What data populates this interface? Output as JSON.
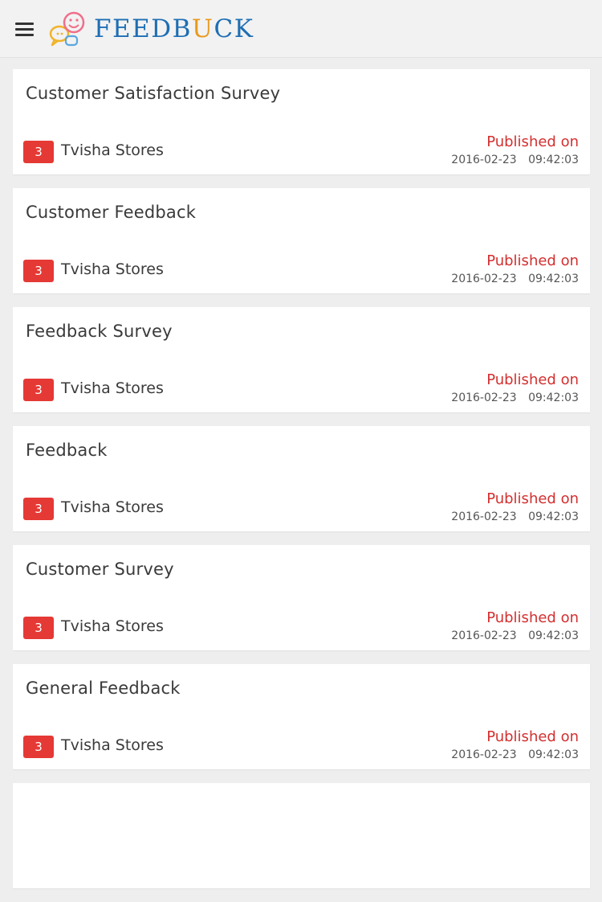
{
  "app": {
    "logo_text_before": "FEEDB",
    "logo_text_accent": "U",
    "logo_text_after": "CK",
    "logo_icon": "speech-bubbles-smiley-icon",
    "menu_icon": "hamburger-menu-icon",
    "colors": {
      "brand_blue": "#1e6eb3",
      "brand_orange": "#e89a1c",
      "badge_red": "#e53935",
      "published_red": "#d32f2f"
    }
  },
  "surveys": [
    {
      "title": "Customer Satisfaction Survey",
      "count": "3",
      "store": "Tvisha Stores",
      "published_label": "Published on",
      "published_at": "2016-02-23 09:42:03"
    },
    {
      "title": "Customer Feedback",
      "count": "3",
      "store": "Tvisha Stores",
      "published_label": "Published on",
      "published_at": "2016-02-23 09:42:03"
    },
    {
      "title": "Feedback Survey",
      "count": "3",
      "store": "Tvisha Stores",
      "published_label": "Published on",
      "published_at": "2016-02-23 09:42:03"
    },
    {
      "title": "Feedback",
      "count": "3",
      "store": "Tvisha Stores",
      "published_label": "Published on",
      "published_at": "2016-02-23 09:42:03"
    },
    {
      "title": "Customer Survey",
      "count": "3",
      "store": "Tvisha Stores",
      "published_label": "Published on",
      "published_at": "2016-02-23 09:42:03"
    },
    {
      "title": "General Feedback",
      "count": "3",
      "store": "Tvisha Stores",
      "published_label": "Published on",
      "published_at": "2016-02-23 09:42:03"
    }
  ]
}
